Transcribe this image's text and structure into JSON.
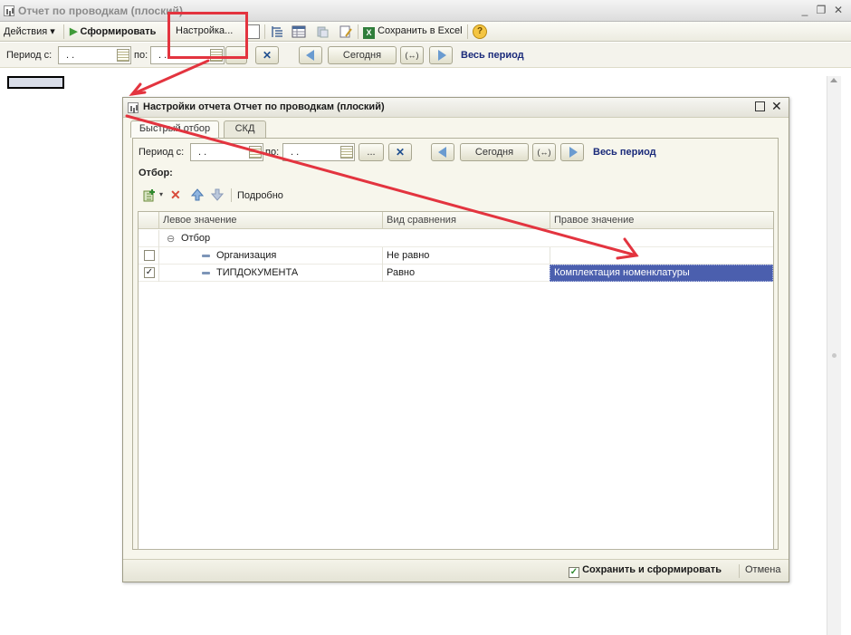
{
  "window": {
    "title": "Отчет по проводкам (плоский)"
  },
  "toolbar": {
    "actions_label": "Действия",
    "generate_label": "Сформировать",
    "settings_label": "Настройка...",
    "save_excel_label": "Сохранить в Excel",
    "help_label": "?"
  },
  "period": {
    "from_label": "Период с:",
    "to_label": "по:",
    "from_value": ". .",
    "to_value": ". .",
    "today_label": "Сегодня",
    "range_label": "(↔)",
    "clear_label": "✕",
    "all_period_label": "Весь период"
  },
  "dialog": {
    "title": "Настройки отчета Отчет по проводкам (плоский)",
    "tabs": [
      {
        "label": "Быстрый отбор",
        "active": true
      },
      {
        "label": "СКД",
        "active": false
      }
    ],
    "period": {
      "from_label": "Период с:",
      "to_label": "по:",
      "from_value": ". .",
      "to_value": ". .",
      "dots_label": "...",
      "clear_label": "✕",
      "today_label": "Сегодня",
      "range_label": "(↔)",
      "all_period_label": "Весь период"
    },
    "filter_label": "Отбор:",
    "filter_toolbar": {
      "details_label": "Подробно"
    },
    "grid": {
      "columns": [
        "Левое значение",
        "Вид сравнения",
        "Правое значение"
      ],
      "group": {
        "symbol": "⊖",
        "label": "Отбор"
      },
      "rows": [
        {
          "checked": false,
          "left": "Организация",
          "comparison": "Не равно",
          "right": ""
        },
        {
          "checked": true,
          "left": "ТИПДОКУМЕНТА",
          "comparison": "Равно",
          "right": "Комплектация номенклатуры"
        }
      ]
    },
    "footer": {
      "save_generate_label": "Сохранить и сформировать",
      "cancel_label": "Отмена"
    }
  },
  "colors": {
    "annotation": "#e3343f",
    "selection": "#4b5fae",
    "link": "#1a2a7a"
  },
  "icons": [
    "report-icon",
    "play-icon",
    "excel-icon",
    "help-icon",
    "calendar-icon",
    "arrow-left-icon",
    "arrow-right-icon",
    "add-icon",
    "delete-icon",
    "move-up-icon",
    "move-down-icon"
  ]
}
